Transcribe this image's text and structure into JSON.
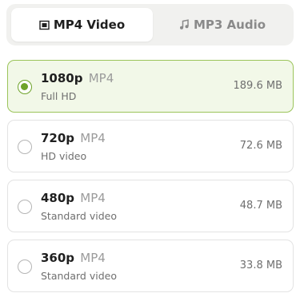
{
  "tabs": {
    "video": {
      "label": "MP4 Video",
      "icon": "film-icon",
      "active": true
    },
    "audio": {
      "label": "MP3 Audio",
      "icon": "music-note-icon",
      "active": false
    }
  },
  "options": [
    {
      "resolution": "1080p",
      "format": "MP4",
      "description": "Full HD",
      "size": "189.6 MB",
      "selected": true
    },
    {
      "resolution": "720p",
      "format": "MP4",
      "description": "HD video",
      "size": "72.6 MB",
      "selected": false
    },
    {
      "resolution": "480p",
      "format": "MP4",
      "description": "Standard video",
      "size": "48.7 MB",
      "selected": false
    },
    {
      "resolution": "360p",
      "format": "MP4",
      "description": "Standard video",
      "size": "33.8 MB",
      "selected": false
    }
  ],
  "colors": {
    "accent": "#6ea32a",
    "selected_background": "#f2f8e8",
    "selected_border": "#9bc45a"
  }
}
